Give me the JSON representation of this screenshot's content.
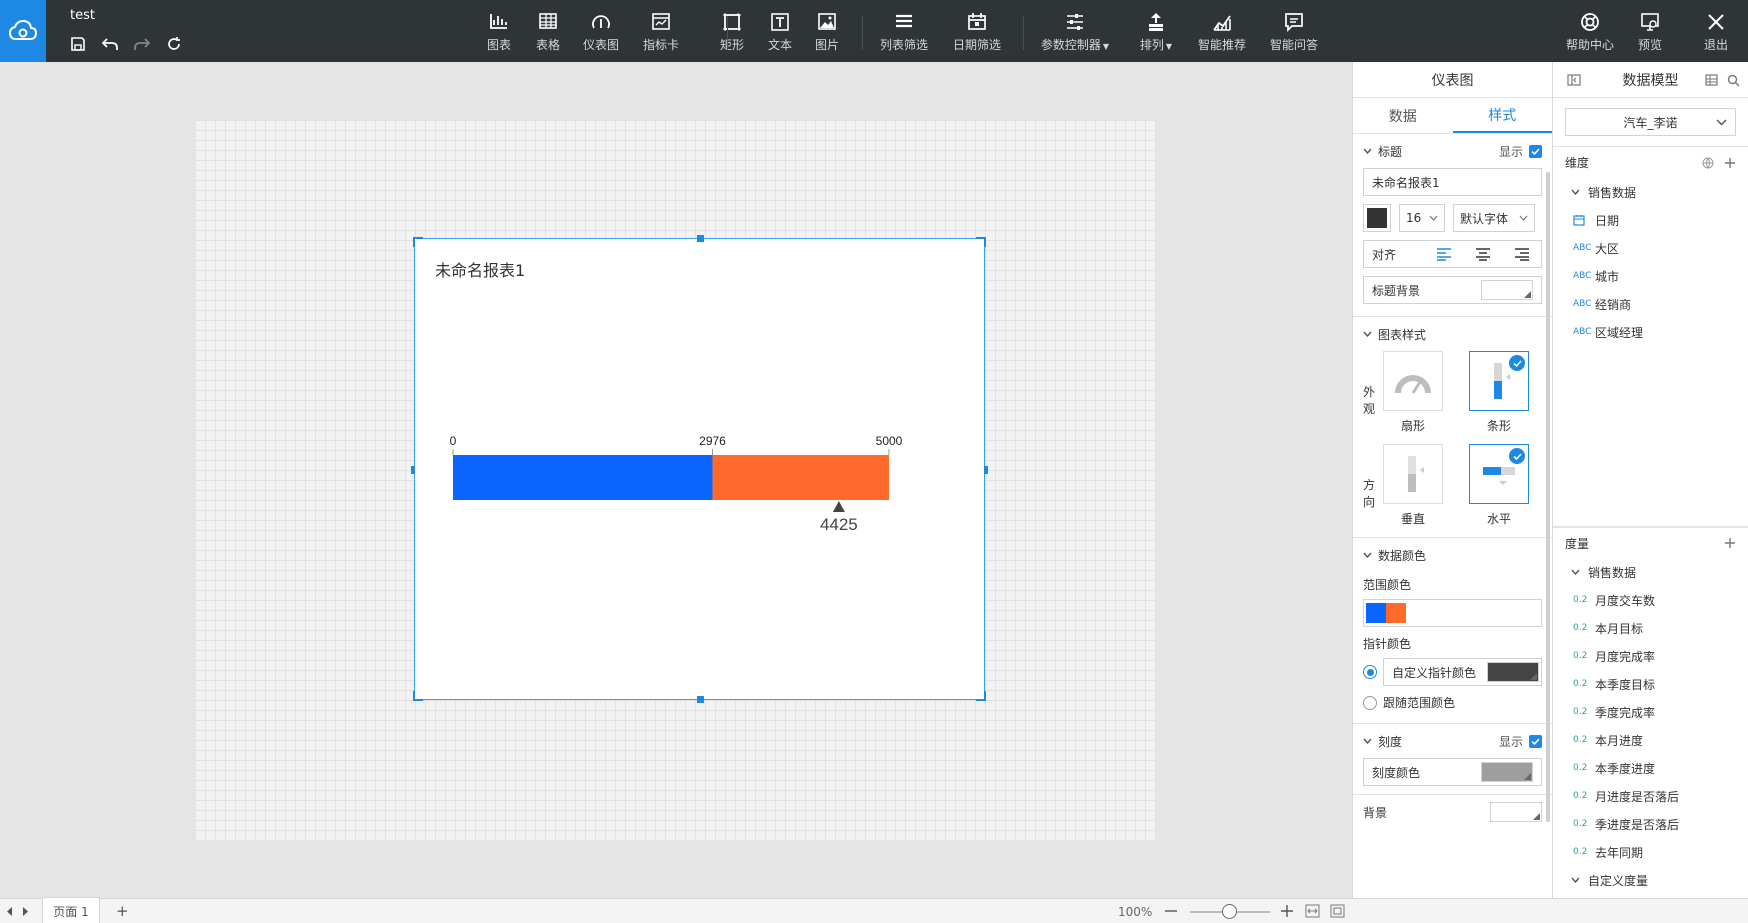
{
  "app": {
    "doc_title": "test"
  },
  "toolbar": {
    "tools": [
      {
        "name": "chart",
        "label": "图表",
        "icon": "bar-chart-icon"
      },
      {
        "name": "table",
        "label": "表格",
        "icon": "table-icon"
      },
      {
        "name": "gauge",
        "label": "仪表图",
        "icon": "gauge-icon"
      },
      {
        "name": "kpi-card",
        "label": "指标卡",
        "icon": "kpi-card-icon"
      },
      {
        "name": "rect",
        "label": "矩形",
        "icon": "rectangle-icon"
      },
      {
        "name": "text",
        "label": "文本",
        "icon": "text-icon"
      },
      {
        "name": "image",
        "label": "图片",
        "icon": "image-icon"
      },
      {
        "name": "list-filter",
        "label": "列表筛选",
        "icon": "list-filter-icon"
      },
      {
        "name": "date-filter",
        "label": "日期筛选",
        "icon": "calendar-icon"
      },
      {
        "name": "param-control",
        "label": "参数控制器",
        "icon": "sliders-icon"
      },
      {
        "name": "arrange",
        "label": "排列",
        "icon": "arrange-icon"
      },
      {
        "name": "smart-recommend",
        "label": "智能推荐",
        "icon": "trend-icon"
      },
      {
        "name": "smart-qa",
        "label": "智能问答",
        "icon": "chat-icon"
      }
    ],
    "right": [
      {
        "name": "help",
        "label": "帮助中心",
        "icon": "lifebuoy-icon"
      },
      {
        "name": "preview",
        "label": "预览",
        "icon": "preview-icon"
      },
      {
        "name": "exit",
        "label": "退出",
        "icon": "close-icon"
      }
    ]
  },
  "widget": {
    "title": "未命名报表1"
  },
  "chart_data": {
    "type": "bar",
    "title": "未命名报表1",
    "range_min": 0,
    "range_max": 5000,
    "value": 2976,
    "pointer": 4425,
    "tick_labels": [
      "0",
      "2976",
      "5000"
    ],
    "pointer_label": "4425",
    "colors": [
      "#0a66ff",
      "#ff6a2a"
    ]
  },
  "style_panel": {
    "header": "仪表图",
    "tabs": [
      "数据",
      "样式"
    ],
    "title_section": {
      "label": "标题",
      "show_label": "显示",
      "title_value": "未命名报表1",
      "font_size": "16",
      "font_family": "默认字体",
      "align_label": "对齐",
      "bg_label": "标题背景"
    },
    "chart_style": {
      "label": "图表样式",
      "appearance_label": "外观",
      "appearance_opts": [
        "扇形",
        "条形"
      ],
      "direction_label": "方向",
      "direction_opts": [
        "垂直",
        "水平"
      ]
    },
    "data_color": {
      "label": "数据颜色",
      "range_label": "范围颜色",
      "pointer_label": "指针颜色",
      "custom_pointer": "自定义指针颜色",
      "follow_range": "跟随范围颜色"
    },
    "scale": {
      "label": "刻度",
      "show_label": "显示",
      "color_label": "刻度颜色"
    },
    "background_label": "背景"
  },
  "data_model": {
    "header": "数据模型",
    "dataset": "汽车_李诺",
    "dimensions_label": "维度",
    "dim_group": "销售数据",
    "dimensions": [
      {
        "type": "date",
        "name": "日期"
      },
      {
        "type": "ABC",
        "name": "大区"
      },
      {
        "type": "ABC",
        "name": "城市"
      },
      {
        "type": "ABC",
        "name": "经销商"
      },
      {
        "type": "ABC",
        "name": "区域经理"
      }
    ],
    "measures_label": "度量",
    "measure_group": "销售数据",
    "measures": [
      "月度交车数",
      "本月目标",
      "月度完成率",
      "本季度目标",
      "季度完成率",
      "本月进度",
      "本季度进度",
      "月进度是否落后",
      "季进度是否落后",
      "去年同期"
    ],
    "measure_tag": "0.2",
    "custom_measures": "自定义度量"
  },
  "footer": {
    "page_tab": "页面 1",
    "add": "+",
    "zoom": "100%"
  }
}
